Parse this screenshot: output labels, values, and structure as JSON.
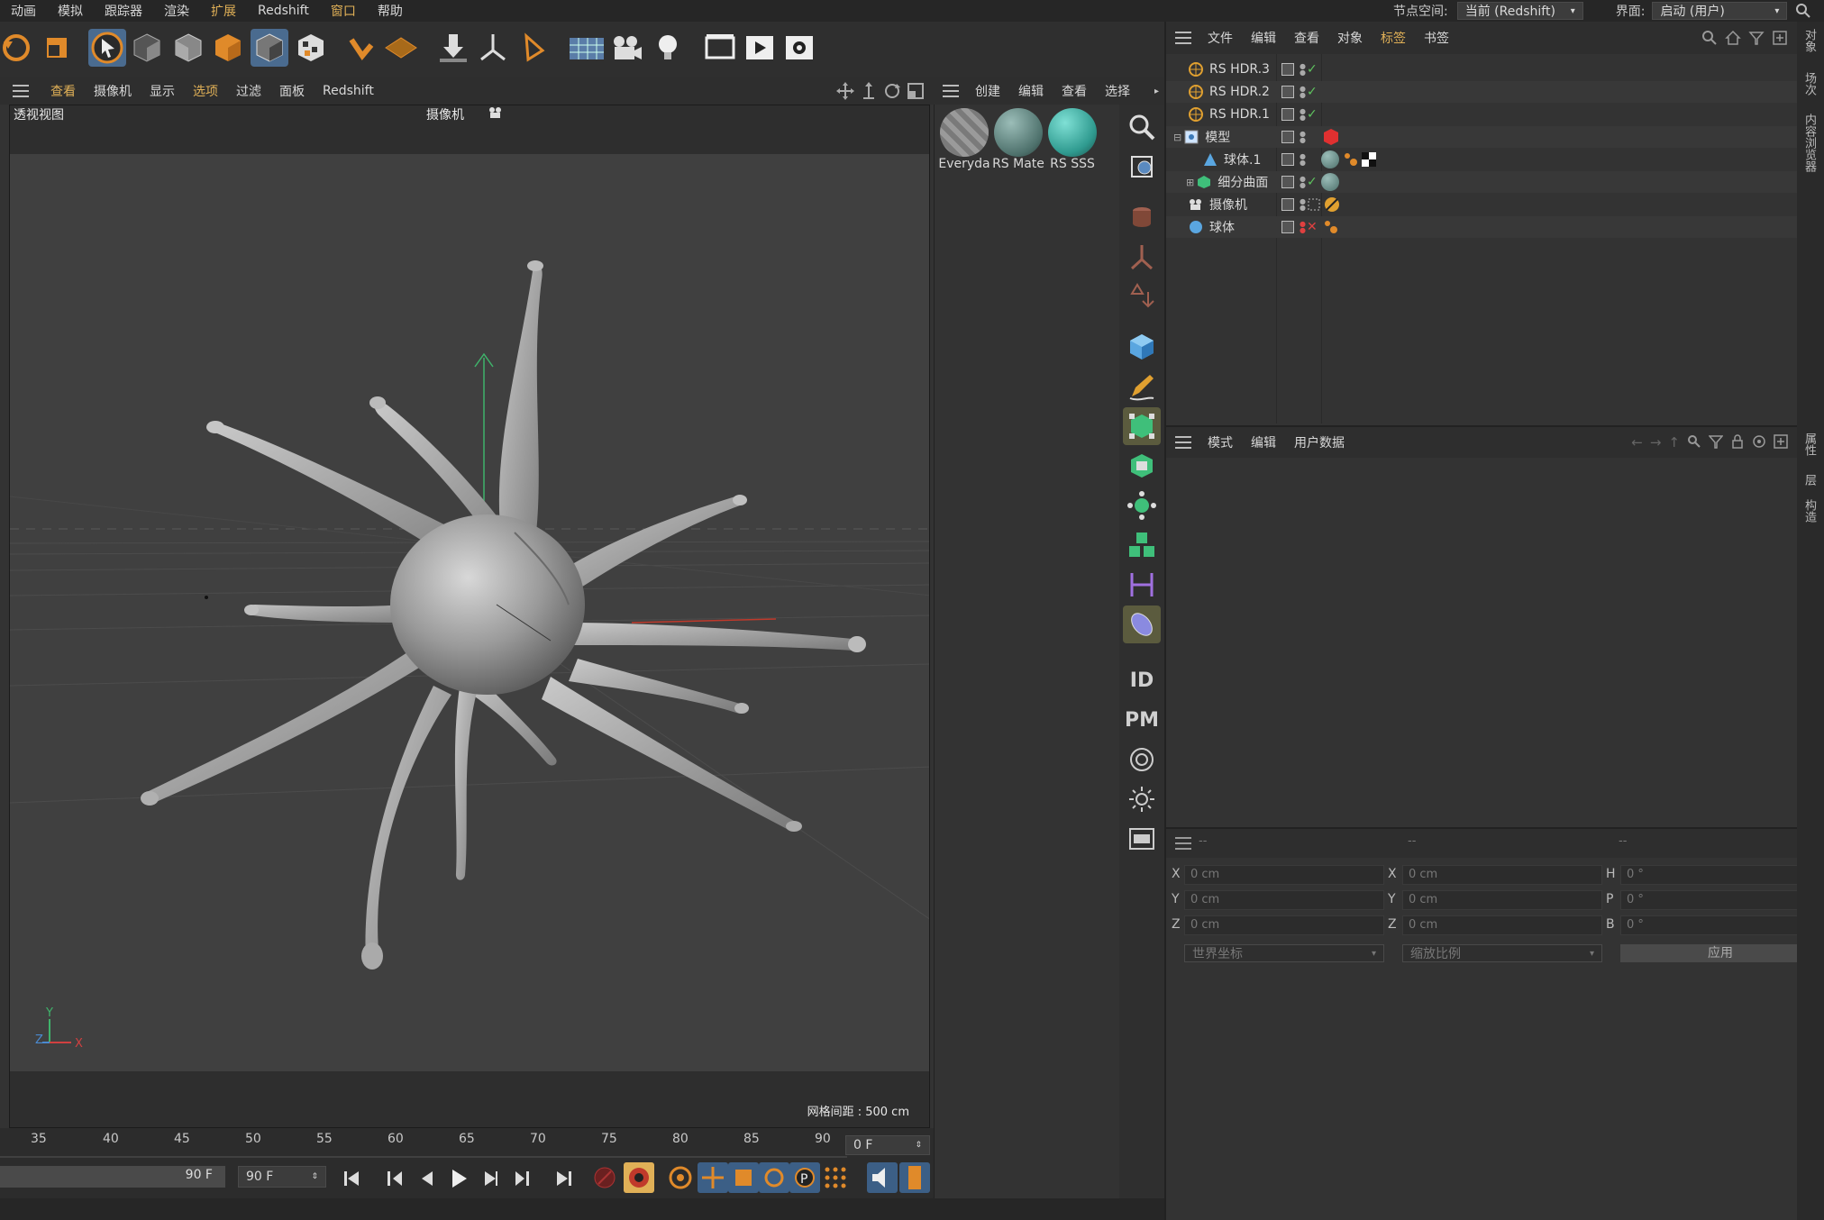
{
  "menubar": {
    "items": [
      "动画",
      "模拟",
      "跟踪器",
      "渲染",
      "扩展",
      "Redshift",
      "窗口",
      "帮助"
    ],
    "node_space_label": "节点空间:",
    "node_space_value": "当前 (Redshift)",
    "layout_label": "界面:",
    "layout_value": "启动 (用户)"
  },
  "toolbar": {
    "icons": [
      "undo-icon",
      "scale-icon",
      "select-icon",
      "model-mode-icon",
      "point-mode-icon",
      "edge-mode-icon",
      "polygon-mode-icon",
      "texture-mode-icon",
      "snap-icon",
      "workplane-icon",
      "drop-icon",
      "axis-icon",
      "play-icon",
      "floor-icon",
      "camera-icon",
      "light-icon",
      "render-region-icon",
      "render-view-icon",
      "render-settings-icon"
    ]
  },
  "viewport": {
    "menu": [
      "查看",
      "摄像机",
      "显示",
      "选项",
      "过滤",
      "面板",
      "Redshift"
    ],
    "title": "透视视图",
    "camera_label": "摄像机",
    "grid_spacing": "网格间距 : 500 cm",
    "axes": {
      "y": "Y",
      "z": "Z",
      "x": "X"
    }
  },
  "timeline": {
    "ticks": [
      "35",
      "40",
      "45",
      "50",
      "55",
      "60",
      "65",
      "70",
      "75",
      "80",
      "85",
      "90"
    ],
    "current_frame": "0 F",
    "end_frame_a": "90 F",
    "end_frame_b": "90 F"
  },
  "materials": {
    "menu": [
      "创建",
      "编辑",
      "查看",
      "选择"
    ],
    "items": [
      {
        "label": "Everyda",
        "color": "#8a8a8a"
      },
      {
        "label": "RS Mate",
        "color": "#5f8a85"
      },
      {
        "label": "RS SSS",
        "color": "#3aa39a"
      }
    ]
  },
  "object_manager": {
    "menu": [
      "文件",
      "编辑",
      "查看",
      "对象",
      "标签",
      "书签"
    ],
    "rows": [
      {
        "name": "RS HDR.3",
        "check": "✓"
      },
      {
        "name": "RS HDR.2",
        "check": "✓"
      },
      {
        "name": "RS HDR.1",
        "check": "✓"
      },
      {
        "name": "模型",
        "check": ""
      },
      {
        "name": "球体.1",
        "check": ""
      },
      {
        "name": "细分曲面",
        "check": "✓"
      },
      {
        "name": "摄像机",
        "check": ""
      },
      {
        "name": "球体",
        "check": "✕"
      }
    ]
  },
  "attributes": {
    "menu": [
      "模式",
      "编辑",
      "用户数据"
    ]
  },
  "coordinates": {
    "header": [
      "--",
      "--",
      "--"
    ],
    "pos": [
      {
        "axis": "X",
        "value": "0 cm"
      },
      {
        "axis": "Y",
        "value": "0 cm"
      },
      {
        "axis": "Z",
        "value": "0 cm"
      }
    ],
    "size": [
      {
        "axis": "X",
        "value": "0 cm"
      },
      {
        "axis": "Y",
        "value": "0 cm"
      },
      {
        "axis": "Z",
        "value": "0 cm"
      }
    ],
    "rot": [
      {
        "axis": "H",
        "value": "0 °"
      },
      {
        "axis": "P",
        "value": "0 °"
      },
      {
        "axis": "B",
        "value": "0 °"
      }
    ],
    "world_coords": "世界坐标",
    "scale_mode": "缩放比例",
    "apply": "应用"
  },
  "right_tabs": [
    "对象",
    "场次",
    "内容浏览器",
    "属性",
    "层",
    "构造"
  ],
  "vstrip": {
    "id_label": "ID",
    "pm_label": "PM"
  },
  "colors": {
    "accent": "#e0b057",
    "active_tool": "#4a6b8f",
    "check_green": "#5fc35f"
  }
}
